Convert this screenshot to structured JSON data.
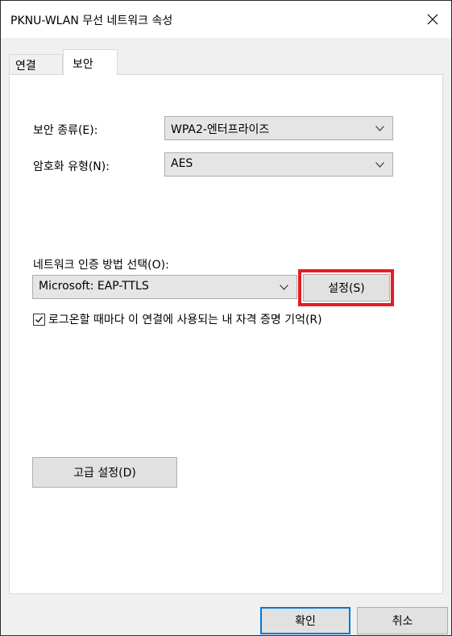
{
  "window": {
    "title": "PKNU-WLAN 무선 네트워크 속성"
  },
  "tabs": [
    {
      "label": "연결",
      "active": false
    },
    {
      "label": "보안",
      "active": true
    }
  ],
  "security": {
    "type_label": "보안 종류(E):",
    "type_value": "WPA2-엔터프라이즈",
    "encryption_label": "암호화 유형(N):",
    "encryption_value": "AES",
    "auth_method_label": "네트워크 인증 방법 선택(O):",
    "auth_method_value": "Microsoft: EAP-TTLS",
    "settings_button": "설정(S)",
    "remember_checkbox_label": "로그온할 때마다 이 연결에 사용되는 내 자격 증명 기억(R)",
    "remember_checked": true,
    "advanced_button": "고급 설정(D)"
  },
  "footer": {
    "ok_button": "확인",
    "cancel_button": "취소"
  },
  "colors": {
    "highlight": "#e31c23",
    "default_button_border": "#0078d7"
  }
}
